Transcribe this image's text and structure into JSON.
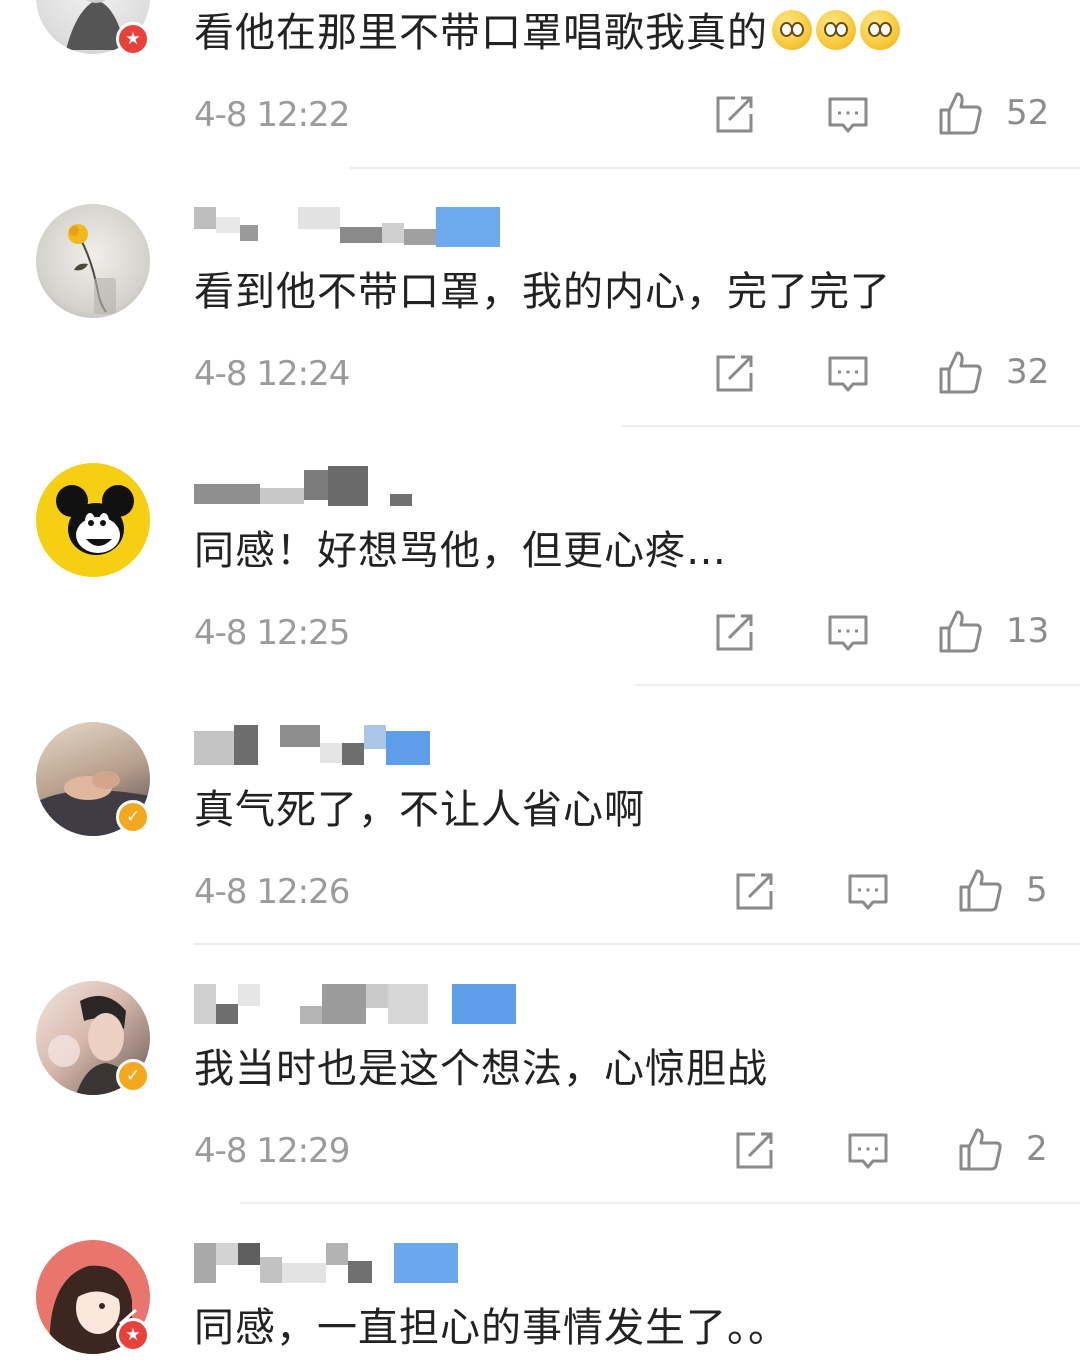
{
  "comments": [
    {
      "content": "看他在那里不带口罩唱歌我真的",
      "emojis": [
        "dizzy-face-emoji",
        "dizzy-face-emoji",
        "dizzy-face-emoji"
      ],
      "time": "4-8 12:22",
      "likes": "52",
      "badge": "star",
      "avatar": "sketch-avatar"
    },
    {
      "content": "看到他不带口罩，我的内心，完了完了",
      "time": "4-8 12:24",
      "likes": "32",
      "avatar": "rose-avatar"
    },
    {
      "content": "同感！好想骂他，但更心疼…",
      "time": "4-8 12:25",
      "likes": "13",
      "avatar": "mickey-avatar"
    },
    {
      "content": "真气死了，不让人省心啊",
      "time": "4-8 12:26",
      "likes": "5",
      "badge": "verified",
      "avatar": "hands-avatar"
    },
    {
      "content": "我当时也是这个想法，心惊胆战",
      "time": "4-8 12:29",
      "likes": "2",
      "badge": "verified",
      "avatar": "man-portrait-avatar"
    },
    {
      "content": "同感，一直担心的事情发生了。。",
      "avatar": "anime-girl-avatar",
      "badge": "star"
    }
  ],
  "icons": {
    "repost": "repost-icon",
    "comment": "comment-icon",
    "like": "thumbs-up-icon"
  },
  "colors": {
    "text": "#222222",
    "meta": "#9b9b9b",
    "badge_red": "#e8413a",
    "badge_gold": "#f3a81e",
    "icon": "#8a8a8a"
  }
}
